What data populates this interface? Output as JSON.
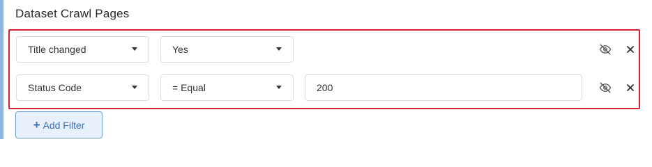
{
  "section": {
    "title": "Dataset Crawl Pages"
  },
  "filters": [
    {
      "field": "Title changed",
      "operator": "Yes",
      "value": null
    },
    {
      "field": "Status Code",
      "operator": "= Equal",
      "value": "200"
    }
  ],
  "actions": {
    "add_filter_label": "Add Filter",
    "add_filter_icon": "+"
  },
  "colors": {
    "highlight_border": "#d32436",
    "accent_bar": "#8fb4dc",
    "button_text": "#3a6fb0",
    "button_bg": "#e8f0fb"
  },
  "icons": {
    "visibility": "eye-off-icon",
    "remove": "close-icon",
    "dropdown": "caret-down-icon"
  }
}
